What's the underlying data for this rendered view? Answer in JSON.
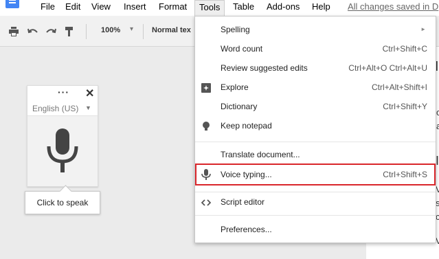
{
  "menubar": {
    "items": [
      "File",
      "Edit",
      "View",
      "Insert",
      "Format",
      "Tools",
      "Table",
      "Add-ons",
      "Help"
    ],
    "active_item": "Tools",
    "saved_status": "All changes saved in D"
  },
  "toolbar": {
    "zoom": "100%",
    "style": "Normal tex"
  },
  "voice_widget": {
    "more_label": "···",
    "close_label": "✕",
    "language": "English (US)",
    "tooltip": "Click to speak"
  },
  "tools_menu": {
    "items": [
      {
        "label": "Spelling",
        "shortcut": "",
        "icon": "none",
        "submenu": true
      },
      {
        "label": "Word count",
        "shortcut": "Ctrl+Shift+C",
        "icon": "none"
      },
      {
        "label": "Review suggested edits",
        "shortcut": "Ctrl+Alt+O Ctrl+Alt+U",
        "icon": "none"
      },
      {
        "label": "Explore",
        "shortcut": "Ctrl+Alt+Shift+I",
        "icon": "explore-icon"
      },
      {
        "label": "Dictionary",
        "shortcut": "Ctrl+Shift+Y",
        "icon": "none"
      },
      {
        "label": "Keep notepad",
        "shortcut": "",
        "icon": "lightbulb-icon"
      },
      {
        "label": "Translate document...",
        "shortcut": "",
        "icon": "none"
      },
      {
        "label": "Voice typing...",
        "shortcut": "Ctrl+Shift+S",
        "icon": "microphone-icon",
        "highlighted": true
      },
      {
        "label": "Script editor",
        "shortcut": "",
        "icon": "code-icon"
      },
      {
        "label": "Preferences...",
        "shortcut": "",
        "icon": "none"
      }
    ]
  },
  "document": {
    "fragments": [
      "I",
      "c",
      "a",
      "I",
      "V",
      "s",
      "c",
      "V"
    ]
  },
  "colors": {
    "highlight_border": "#d9252a",
    "docs_blue": "#4285f4"
  }
}
